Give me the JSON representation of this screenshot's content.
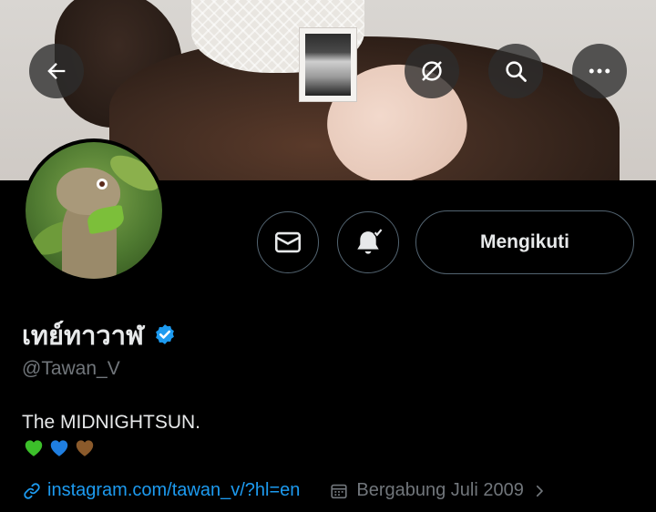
{
  "header": {
    "back_icon": "arrow-left-icon",
    "translate_icon": "circle-slash-icon",
    "search_icon": "search-icon",
    "more_icon": "more-horizontal-icon"
  },
  "profile": {
    "display_name": "เทย์ทาวาฬ",
    "verified": true,
    "handle": "@Tawan_V",
    "bio": "The MIDNIGHTSUN.",
    "bio_emoji": [
      "green-heart",
      "blue-heart",
      "brown-heart"
    ],
    "link_text": "instagram.com/tawan_v/?hl=en",
    "joined_text": "Bergabung Juli 2009"
  },
  "actions": {
    "message_icon": "mail-icon",
    "notify_icon": "bell-check-icon",
    "follow_label": "Mengikuti"
  },
  "colors": {
    "background": "#000000",
    "accent": "#1d9bf0",
    "muted": "#71767b",
    "border": "#536471",
    "heart_green": "#3cbf2a",
    "heart_blue": "#1f7ee0",
    "heart_brown": "#8b5a2b"
  }
}
